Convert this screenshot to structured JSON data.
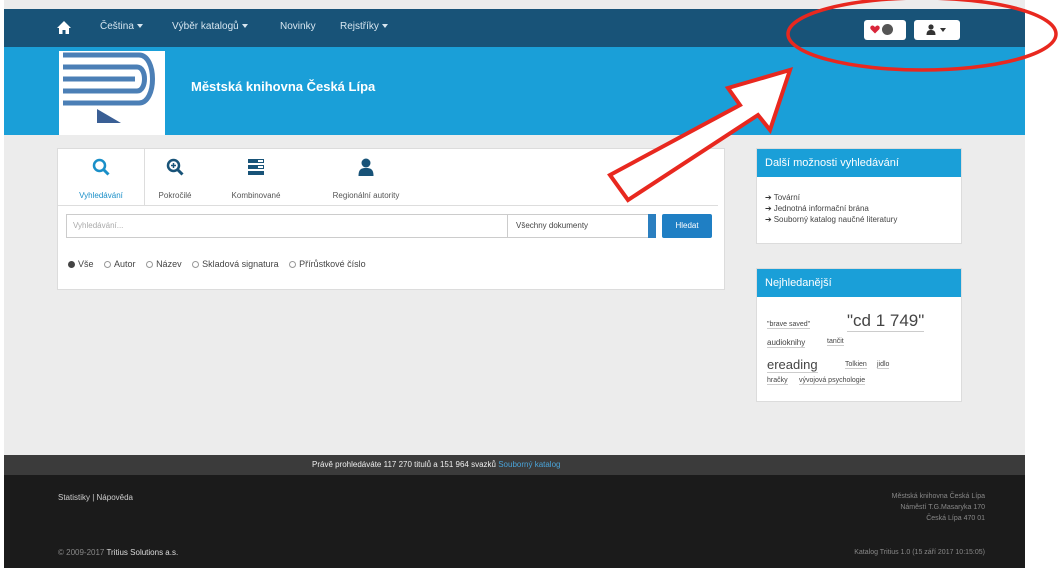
{
  "nav": {
    "items": [
      {
        "label": "Čeština",
        "caret": true
      },
      {
        "label": "Výběr katalogů",
        "caret": true
      },
      {
        "label": "Novinky",
        "caret": false
      },
      {
        "label": "Rejstříky",
        "caret": true
      }
    ]
  },
  "header": {
    "title": "Městská knihovna Česká Lípa"
  },
  "search": {
    "tabs": [
      "Vyhledávání",
      "Pokročilé",
      "Kombinované",
      "Regionální autority"
    ],
    "placeholder": "Vyhledávání...",
    "doc_type": "Všechny dokumenty",
    "button": "Hledat",
    "radios": [
      "Vše",
      "Autor",
      "Název",
      "Skladová signatura",
      "Přírůstkové číslo"
    ]
  },
  "more": {
    "title": "Další možnosti vyhledávání",
    "links": [
      "Tovární",
      "Jednotná informační brána",
      "Souborný katalog naučné literatury"
    ]
  },
  "popular": {
    "title": "Nejhledanější",
    "tags": [
      "\"brave saved\"",
      "\"cd 1 749\"",
      "audioknihy",
      "tančit",
      "ereading",
      "Tolkien",
      "jidlo",
      "hračky",
      "vývojová psychologie"
    ]
  },
  "footer": {
    "stat_text": "Právě prohledáváte 117 270 titulů a 151 964 svazků",
    "stat_link": "Souborný katalog",
    "links": "Statistiky | Nápověda",
    "copy_prefix": "© 2009-2017",
    "copy_name": "Tritius Solutions a.s.",
    "address": [
      "Městská knihovna Česká Lípa",
      "Náměstí T.G.Masaryka 170",
      "Česká Lípa 470 01"
    ],
    "version": "Katalog Tritius 1.0 (15 září 2017 10:15:05)"
  },
  "colors": {
    "navbar": "#185378",
    "header": "#1a9fd8",
    "annotation": "#e8281f"
  }
}
